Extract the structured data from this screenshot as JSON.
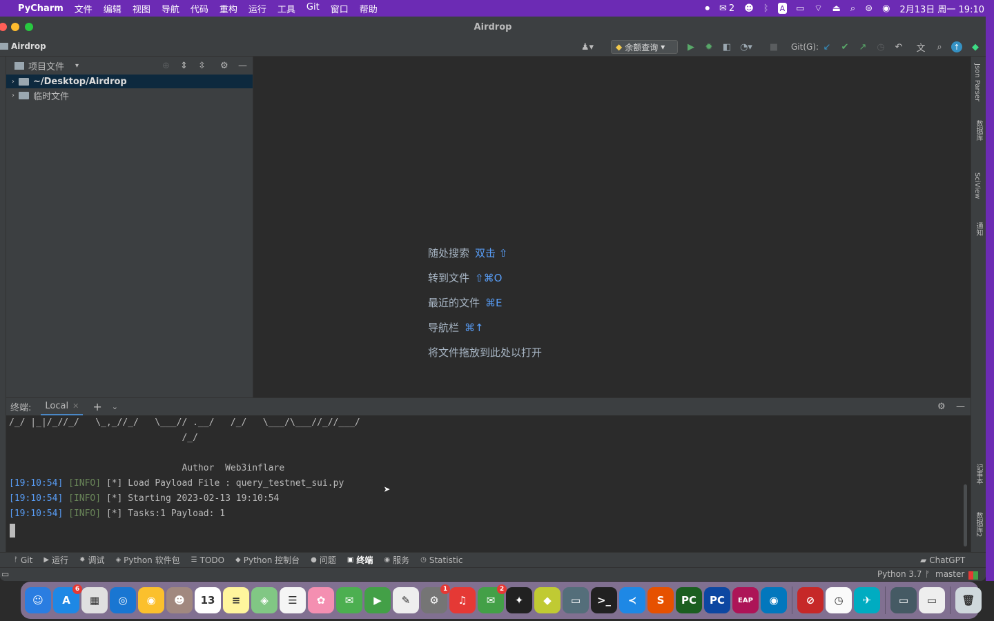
{
  "menubar": {
    "app_name": "PyCharm",
    "items": [
      "文件",
      "编辑",
      "视图",
      "导航",
      "代码",
      "重构",
      "运行",
      "工具",
      "Git",
      "窗口",
      "帮助"
    ],
    "wechat_count": "2",
    "input_method": "A",
    "datetime": "2月13日 周一 19:10"
  },
  "window": {
    "title": "Airdrop",
    "project_name": "Airdrop"
  },
  "toolbar": {
    "run_config": "余额查询",
    "git_label": "Git(G):"
  },
  "project_panel": {
    "title": "项目文件",
    "tree": [
      {
        "label": "~/Desktop/Airdrop",
        "selected": true
      },
      {
        "label": "临时文件",
        "selected": false
      }
    ]
  },
  "editor_hints": [
    {
      "text": "随处搜索",
      "key": "双击 ⇧"
    },
    {
      "text": "转到文件",
      "key": "⇧⌘O"
    },
    {
      "text": "最近的文件",
      "key": "⌘E"
    },
    {
      "text": "导航栏",
      "key": "⌘↑"
    },
    {
      "text": "将文件拖放到此处以打开",
      "key": ""
    }
  ],
  "right_strip": [
    "Json Parser",
    "数据库",
    "SciView",
    "通知",
    "记事本",
    "数据库2"
  ],
  "terminal": {
    "label": "终端:",
    "tab": "Local",
    "ascii_line1": "/_/ |_|/_//_/   \\_,_//_/   \\___// .__/   /_/   \\___/\\___//_//___/",
    "ascii_line2": "                                /_/",
    "author_line": "                                Author  Web3inflare",
    "log": [
      {
        "time": "[19:10:54]",
        "level": "[INFO]",
        "msg": " [*] Load Payload File : query_testnet_sui.py"
      },
      {
        "time": "[19:10:54]",
        "level": "[INFO]",
        "msg": " [*] Starting 2023-02-13 19:10:54"
      },
      {
        "time": "[19:10:54]",
        "level": "[INFO]",
        "msg": " [*] Tasks:1 Payload: 1"
      }
    ]
  },
  "bottom_tabs": [
    {
      "label": "Git",
      "icon": "git-icon"
    },
    {
      "label": "运行",
      "icon": "run-icon"
    },
    {
      "label": "调试",
      "icon": "debug-icon"
    },
    {
      "label": "Python 软件包",
      "icon": "packages-icon"
    },
    {
      "label": "TODO",
      "icon": "todo-icon"
    },
    {
      "label": "Python 控制台",
      "icon": "console-icon"
    },
    {
      "label": "问题",
      "icon": "problems-icon"
    },
    {
      "label": "终端",
      "icon": "terminal-icon",
      "active": true
    },
    {
      "label": "服务",
      "icon": "services-icon"
    },
    {
      "label": "Statistic",
      "icon": "statistic-icon"
    }
  ],
  "chatgpt_label": "ChatGPT",
  "status": {
    "interpreter": "Python 3.7",
    "branch": "master"
  },
  "dock": [
    {
      "name": "finder",
      "color": "#2a7de1",
      "glyph": "☺"
    },
    {
      "name": "app-store",
      "color": "#1e88e5",
      "glyph": "A",
      "badge": "6"
    },
    {
      "name": "launchpad",
      "color": "#e0e0e0",
      "glyph": "▦"
    },
    {
      "name": "safari",
      "color": "#1976d2",
      "glyph": "◎"
    },
    {
      "name": "chrome",
      "color": "#fbc02d",
      "glyph": "◉"
    },
    {
      "name": "contacts",
      "color": "#a1887f",
      "glyph": "☻"
    },
    {
      "name": "calendar",
      "color": "#ffffff",
      "glyph": "13"
    },
    {
      "name": "notes",
      "color": "#fff59d",
      "glyph": "≡"
    },
    {
      "name": "maps",
      "color": "#81c784",
      "glyph": "◈"
    },
    {
      "name": "reminders",
      "color": "#f5f5f5",
      "glyph": "☰"
    },
    {
      "name": "photos",
      "color": "#f48fb1",
      "glyph": "✿"
    },
    {
      "name": "messages",
      "color": "#4caf50",
      "glyph": "✉"
    },
    {
      "name": "facetime",
      "color": "#43a047",
      "glyph": "▶"
    },
    {
      "name": "textedit",
      "color": "#eeeeee",
      "glyph": "✎"
    },
    {
      "name": "system-preferences",
      "color": "#757575",
      "glyph": "⚙",
      "badge": "1"
    },
    {
      "name": "netease-music",
      "color": "#e53935",
      "glyph": "♫"
    },
    {
      "name": "wechat",
      "color": "#43a047",
      "glyph": "✉",
      "badge": "2"
    },
    {
      "name": "qq",
      "color": "#212121",
      "glyph": "✦"
    },
    {
      "name": "app-green",
      "color": "#c0ca33",
      "glyph": "◆"
    },
    {
      "name": "screen-share",
      "color": "#546e7a",
      "glyph": "▭"
    },
    {
      "name": "terminal",
      "color": "#212121",
      "glyph": ">_"
    },
    {
      "name": "vscode",
      "color": "#1e88e5",
      "glyph": "≺"
    },
    {
      "name": "sublime",
      "color": "#e65100",
      "glyph": "S"
    },
    {
      "name": "pycharm",
      "color": "#1b5e20",
      "glyph": "PC"
    },
    {
      "name": "pycharm-ce",
      "color": "#0d47a1",
      "glyph": "PC"
    },
    {
      "name": "eap",
      "color": "#ad1457",
      "glyph": "EAP"
    },
    {
      "name": "proxyman",
      "color": "#0277bd",
      "glyph": "◉"
    },
    {
      "name": "app-red",
      "color": "#c62828",
      "glyph": "⊘"
    },
    {
      "name": "clock",
      "color": "#fafafa",
      "glyph": "◷"
    },
    {
      "name": "lark",
      "color": "#00acc1",
      "glyph": "✈"
    },
    {
      "name": "window1",
      "color": "#455a64",
      "glyph": "▭"
    },
    {
      "name": "window2",
      "color": "#eeeeee",
      "glyph": "▭"
    },
    {
      "name": "trash",
      "color": "#cfd8dc",
      "glyph": "🗑"
    }
  ]
}
